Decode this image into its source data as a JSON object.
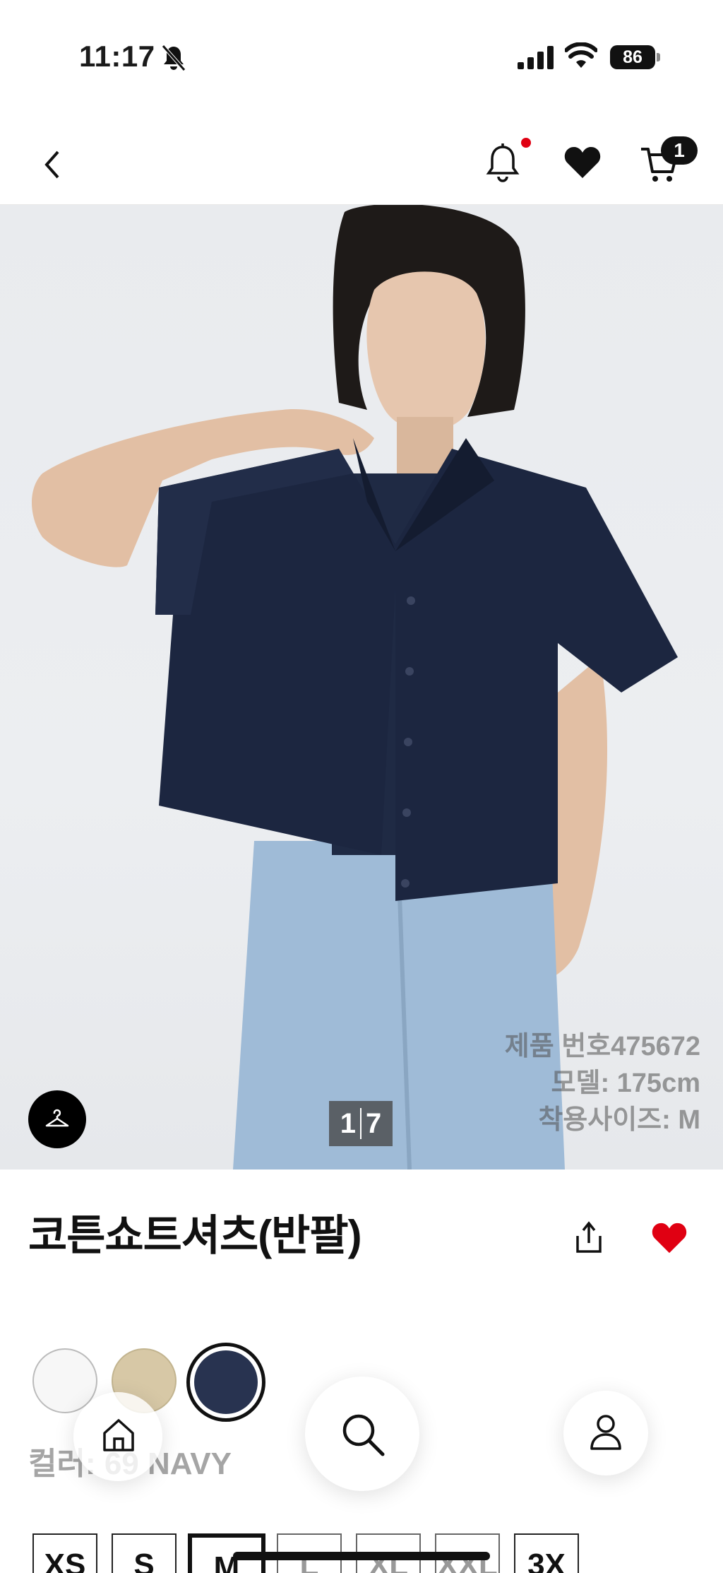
{
  "status_bar": {
    "time": "11:17",
    "battery": "86"
  },
  "header": {
    "cart_count": "1",
    "icons": [
      "back-icon",
      "bell-icon",
      "heart-icon",
      "cart-icon"
    ]
  },
  "gallery": {
    "page_current": "1",
    "page_total": "7",
    "info_lines": [
      "제품 번호475672",
      "모델: 175cm",
      "착용사이즈: M"
    ]
  },
  "product": {
    "title": "코튼쇼트셔츠(반팔)"
  },
  "colors": {
    "label": "컬러: 69 NAVY",
    "swatches": [
      "#f7f7f7",
      "#d7c8a6",
      "#283350"
    ]
  },
  "sizes": [
    "XS",
    "S",
    "M",
    "L",
    "XL",
    "XXL",
    "3X"
  ],
  "theme": {
    "accent": "#e00012"
  }
}
